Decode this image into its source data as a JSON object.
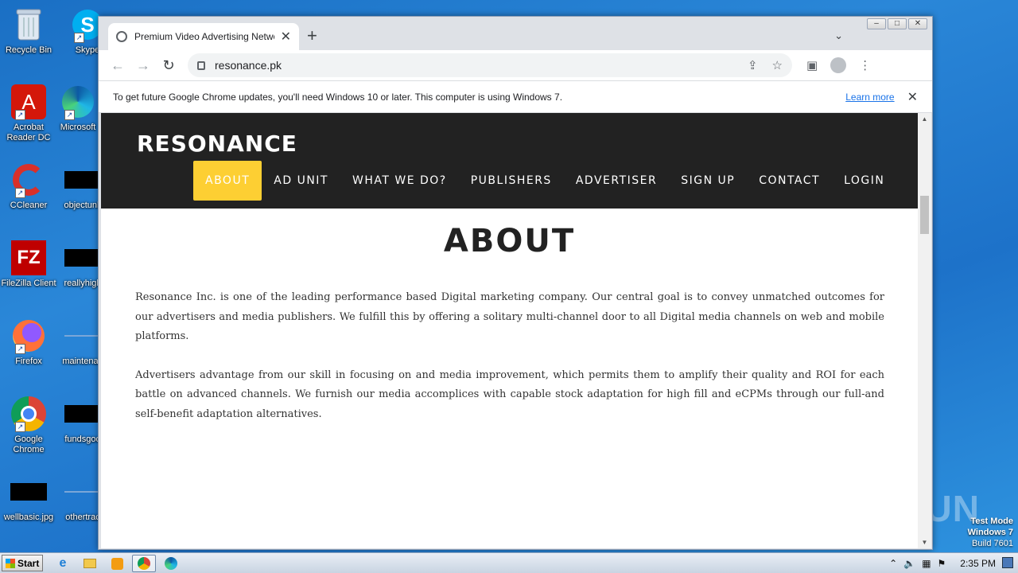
{
  "desktop": {
    "icons": [
      {
        "label": "Recycle Bin"
      },
      {
        "label": "Skype"
      },
      {
        "label": "Acrobat Reader DC"
      },
      {
        "label": "Microsoft"
      },
      {
        "label": "CCleaner"
      },
      {
        "label": "objectunk"
      },
      {
        "label": "FileZilla Client"
      },
      {
        "label": "reallyhigh"
      },
      {
        "label": "Firefox"
      },
      {
        "label": "maintenan"
      },
      {
        "label": "Google Chrome"
      },
      {
        "label": "fundsgoo"
      },
      {
        "label": "wellbasic.jpg"
      },
      {
        "label": "othertrac"
      }
    ],
    "watermark": "ANY RUN",
    "test_mode": {
      "line1": "Test Mode",
      "line2": "Windows 7",
      "line3": "Build 7601"
    }
  },
  "browser": {
    "tab_title": "Premium Video Advertising Network",
    "url": "resonance.pk",
    "infobar": {
      "message": "To get future Google Chrome updates, you'll need Windows 10 or later. This computer is using Windows 7.",
      "link": "Learn more"
    }
  },
  "site": {
    "logo": "RESONANCE",
    "nav": [
      "ABOUT",
      "AD UNIT",
      "WHAT WE DO?",
      "PUBLISHERS",
      "ADVERTISER",
      "SIGN UP",
      "CONTACT",
      "LOGIN"
    ],
    "heading": "ABOUT",
    "paragraphs": [
      "Resonance Inc. is one of the leading performance based Digital marketing company. Our central goal is to convey unmatched outcomes for our advertisers and media publishers. We fulfill this by offering a solitary multi-channel door to all Digital media channels on web and mobile platforms.",
      "Advertisers advantage from our skill in focusing on and media improvement, which permits them to amplify their quality and ROI for each battle on advanced channels. We furnish our media accomplices with capable stock adaptation for high fill and eCPMs through our full-and self-benefit adaptation alternatives."
    ],
    "accent_color": "#fdcf33"
  },
  "taskbar": {
    "start_label": "Start",
    "clock": "2:35 PM"
  }
}
